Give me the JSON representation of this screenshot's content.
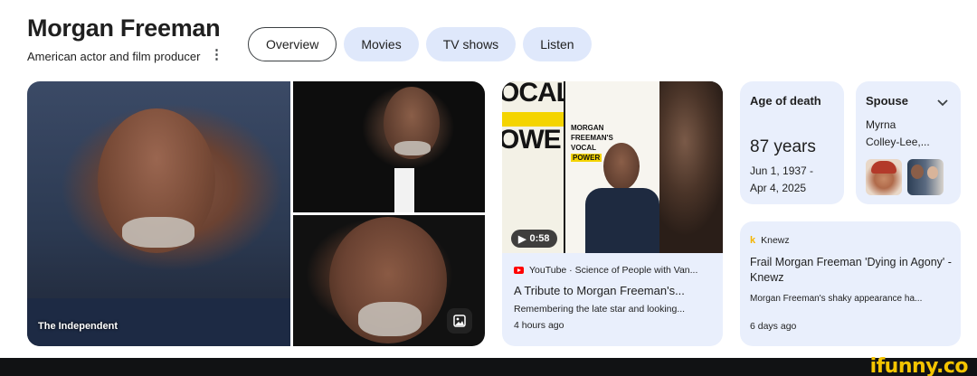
{
  "header": {
    "title": "Morgan Freeman",
    "subtitle": "American actor and film producer",
    "more_icon": "kebab-icon"
  },
  "tabs": [
    {
      "label": "Overview",
      "active": true
    },
    {
      "label": "Movies",
      "active": false
    },
    {
      "label": "TV shows",
      "active": false
    },
    {
      "label": "Listen",
      "active": false
    }
  ],
  "gallery": {
    "main_caption": "The Independent",
    "image_icon": "image-search-icon"
  },
  "video": {
    "poster_words": [
      "OCAL",
      "OWE"
    ],
    "poster_text": [
      "MORGAN",
      "FREEMAN'S",
      "VOCAL",
      "POWER"
    ],
    "duration": "0:58",
    "source": "YouTube · Science of People with Van...",
    "title": "A Tribute to Morgan Freeman's...",
    "description": "Remembering the late star and looking...",
    "time": "4 hours ago"
  },
  "age_card": {
    "label": "Age of death",
    "value": "87 years",
    "birth": "Jun 1, 1937 -",
    "death": "Apr 4, 2025"
  },
  "spouse_card": {
    "label": "Spouse",
    "name_line1": "Myrna",
    "name_line2": "Colley-Lee,..."
  },
  "news": {
    "source_logo": "k",
    "source": "Knewz",
    "title": "Frail Morgan Freeman 'Dying in Agony' - Knewz",
    "description": "Morgan Freeman's shaky appearance ha...",
    "time": "6 days ago"
  },
  "watermark": "ifunny.co",
  "colors": {
    "chip_bg": "#dfe8fb",
    "card_bg": "#e9effc",
    "youtube_red": "#ff0000",
    "poster_highlight": "#f4d400",
    "watermark": "#f4c400"
  }
}
